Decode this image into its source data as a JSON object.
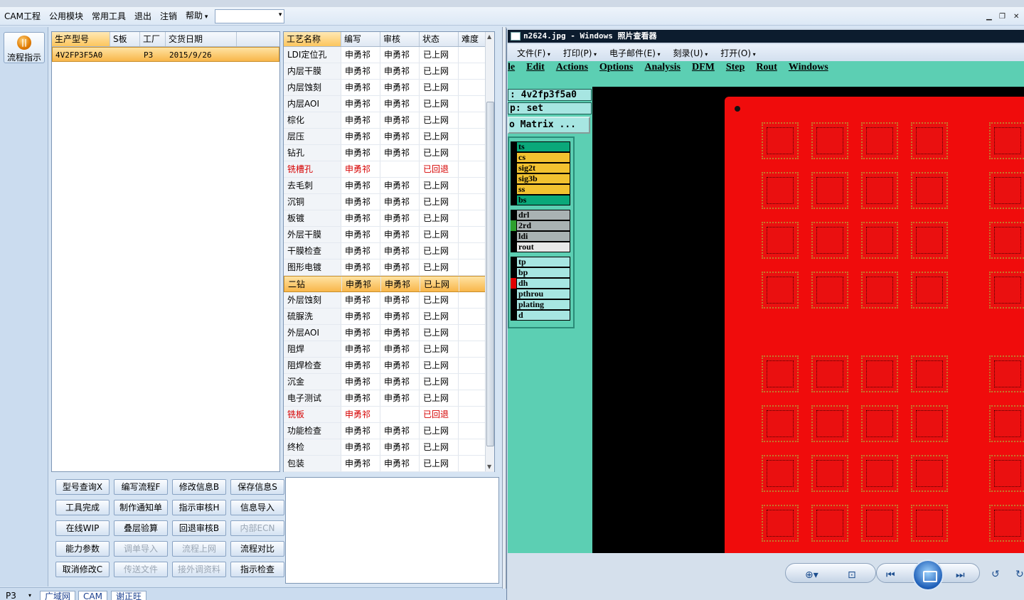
{
  "menubar": {
    "items": [
      "CAM工程",
      "公用模块",
      "常用工具",
      "退出",
      "注销",
      "帮助"
    ],
    "combo_value": ""
  },
  "leftbar": {
    "flow_button": "流程指示"
  },
  "orders": {
    "columns": [
      "生产型号",
      "S板",
      "工厂",
      "交货日期"
    ],
    "rows": [
      {
        "model": "4V2FP3F5A0",
        "s": "",
        "factory": "P3",
        "date": "2015/9/26"
      }
    ]
  },
  "process": {
    "columns": [
      "工艺名称",
      "编写",
      "审核",
      "状态",
      "难度"
    ],
    "rows": [
      {
        "name": "LDI定位孔",
        "writer": "申勇祁",
        "reviewer": "申勇祁",
        "status": "已上网",
        "level": "",
        "flag": ""
      },
      {
        "name": "内层干膜",
        "writer": "申勇祁",
        "reviewer": "申勇祁",
        "status": "已上网",
        "level": "",
        "flag": ""
      },
      {
        "name": "内层蚀刻",
        "writer": "申勇祁",
        "reviewer": "申勇祁",
        "status": "已上网",
        "level": "",
        "flag": ""
      },
      {
        "name": "内层AOI",
        "writer": "申勇祁",
        "reviewer": "申勇祁",
        "status": "已上网",
        "level": "",
        "flag": ""
      },
      {
        "name": "棕化",
        "writer": "申勇祁",
        "reviewer": "申勇祁",
        "status": "已上网",
        "level": "",
        "flag": ""
      },
      {
        "name": "层压",
        "writer": "申勇祁",
        "reviewer": "申勇祁",
        "status": "已上网",
        "level": "",
        "flag": ""
      },
      {
        "name": "钻孔",
        "writer": "申勇祁",
        "reviewer": "申勇祁",
        "status": "已上网",
        "level": "",
        "flag": ""
      },
      {
        "name": "铣槽孔",
        "writer": "申勇祁",
        "reviewer": "",
        "status": "已回退",
        "level": "",
        "flag": "red"
      },
      {
        "name": "去毛刺",
        "writer": "申勇祁",
        "reviewer": "申勇祁",
        "status": "已上网",
        "level": "",
        "flag": ""
      },
      {
        "name": "沉铜",
        "writer": "申勇祁",
        "reviewer": "申勇祁",
        "status": "已上网",
        "level": "",
        "flag": ""
      },
      {
        "name": "板镀",
        "writer": "申勇祁",
        "reviewer": "申勇祁",
        "status": "已上网",
        "level": "",
        "flag": ""
      },
      {
        "name": "外层干膜",
        "writer": "申勇祁",
        "reviewer": "申勇祁",
        "status": "已上网",
        "level": "",
        "flag": ""
      },
      {
        "name": "干膜检查",
        "writer": "申勇祁",
        "reviewer": "申勇祁",
        "status": "已上网",
        "level": "",
        "flag": ""
      },
      {
        "name": "图形电镀",
        "writer": "申勇祁",
        "reviewer": "申勇祁",
        "status": "已上网",
        "level": "",
        "flag": ""
      },
      {
        "name": "二钻",
        "writer": "申勇祁",
        "reviewer": "申勇祁",
        "status": "已上网",
        "level": "",
        "flag": "sel"
      },
      {
        "name": "外层蚀刻",
        "writer": "申勇祁",
        "reviewer": "申勇祁",
        "status": "已上网",
        "level": "",
        "flag": ""
      },
      {
        "name": "硫脲洗",
        "writer": "申勇祁",
        "reviewer": "申勇祁",
        "status": "已上网",
        "level": "",
        "flag": ""
      },
      {
        "name": "外层AOI",
        "writer": "申勇祁",
        "reviewer": "申勇祁",
        "status": "已上网",
        "level": "",
        "flag": ""
      },
      {
        "name": "阻焊",
        "writer": "申勇祁",
        "reviewer": "申勇祁",
        "status": "已上网",
        "level": "",
        "flag": ""
      },
      {
        "name": "阻焊检查",
        "writer": "申勇祁",
        "reviewer": "申勇祁",
        "status": "已上网",
        "level": "",
        "flag": ""
      },
      {
        "name": "沉金",
        "writer": "申勇祁",
        "reviewer": "申勇祁",
        "status": "已上网",
        "level": "",
        "flag": ""
      },
      {
        "name": "电子测试",
        "writer": "申勇祁",
        "reviewer": "申勇祁",
        "status": "已上网",
        "level": "",
        "flag": ""
      },
      {
        "name": "铣板",
        "writer": "申勇祁",
        "reviewer": "",
        "status": "已回退",
        "level": "",
        "flag": "red"
      },
      {
        "name": "功能检查",
        "writer": "申勇祁",
        "reviewer": "申勇祁",
        "status": "已上网",
        "level": "",
        "flag": ""
      },
      {
        "name": "终检",
        "writer": "申勇祁",
        "reviewer": "申勇祁",
        "status": "已上网",
        "level": "",
        "flag": ""
      },
      {
        "name": "包装",
        "writer": "申勇祁",
        "reviewer": "申勇祁",
        "status": "已上网",
        "level": "",
        "flag": ""
      }
    ]
  },
  "buttons": [
    [
      {
        "label": "型号查询X",
        "enabled": true
      },
      {
        "label": "编写流程F",
        "enabled": true
      },
      {
        "label": "修改信息B",
        "enabled": true
      },
      {
        "label": "保存信息S",
        "enabled": true
      }
    ],
    [
      {
        "label": "工具完成",
        "enabled": true
      },
      {
        "label": "制作通知单",
        "enabled": true
      },
      {
        "label": "指示审核H",
        "enabled": true
      },
      {
        "label": "信息导入",
        "enabled": true
      }
    ],
    [
      {
        "label": "在线WIP",
        "enabled": true
      },
      {
        "label": "叠层验算",
        "enabled": true
      },
      {
        "label": "回退审核B",
        "enabled": true
      },
      {
        "label": "内部ECN",
        "enabled": false
      }
    ],
    [
      {
        "label": "能力参数",
        "enabled": true
      },
      {
        "label": "调单导入",
        "enabled": false
      },
      {
        "label": "流程上网",
        "enabled": false
      },
      {
        "label": "流程对比",
        "enabled": true
      }
    ],
    [
      {
        "label": "取消修改C",
        "enabled": true
      },
      {
        "label": "传送文件",
        "enabled": false
      },
      {
        "label": "接外调资料",
        "enabled": false
      },
      {
        "label": "指示检查",
        "enabled": true
      }
    ]
  ],
  "statusbar": {
    "factory": "P3",
    "tabs": [
      "广域网",
      "CAM",
      "谢正旺"
    ]
  },
  "viewer": {
    "title": "n2624.jpg - Windows 照片查看器",
    "menu": [
      "文件(F)",
      "打印(P)",
      "电子邮件(E)",
      "刻录(U)",
      "打开(O)"
    ],
    "genesis_menu": [
      "le",
      "Edit",
      "Actions",
      "Options",
      "Analysis",
      "DFM",
      "Step",
      "Rout",
      "Windows"
    ],
    "job_line": ": 4v2fp3f5a0",
    "step_line": "p: set",
    "matrix_label": "o Matrix ...",
    "layers": [
      {
        "name": "ts",
        "color": "#0aa87a",
        "swatch": "#000"
      },
      {
        "name": "cs",
        "color": "#f2c230",
        "swatch": "#000"
      },
      {
        "name": "sig2t",
        "color": "#f2c230",
        "swatch": "#000"
      },
      {
        "name": "sig3b",
        "color": "#f2c230",
        "swatch": "#000"
      },
      {
        "name": "ss",
        "color": "#f2c230",
        "swatch": "#000"
      },
      {
        "name": "bs",
        "color": "#0aa87a",
        "swatch": "#000"
      },
      {
        "name": "drl",
        "color": "#a9b2b3",
        "swatch": "#000"
      },
      {
        "name": "2rd",
        "color": "#a9b2b3",
        "swatch": "#2ea02e"
      },
      {
        "name": "ldi",
        "color": "#a9b2b3",
        "swatch": "#000"
      },
      {
        "name": "rout",
        "color": "#e8e8e8",
        "swatch": "#000"
      },
      {
        "name": "tp",
        "color": "#a7e6e2",
        "swatch": "#000"
      },
      {
        "name": "bp",
        "color": "#a7e6e2",
        "swatch": "#000"
      },
      {
        "name": "dh",
        "color": "#a7e6e2",
        "swatch": "#e00000"
      },
      {
        "name": "pthrou",
        "color": "#a7e6e2",
        "swatch": "#000"
      },
      {
        "name": "plating",
        "color": "#a7e6e2",
        "swatch": "#000"
      },
      {
        "name": "d",
        "color": "#a7e6e2",
        "swatch": "#000"
      }
    ]
  }
}
